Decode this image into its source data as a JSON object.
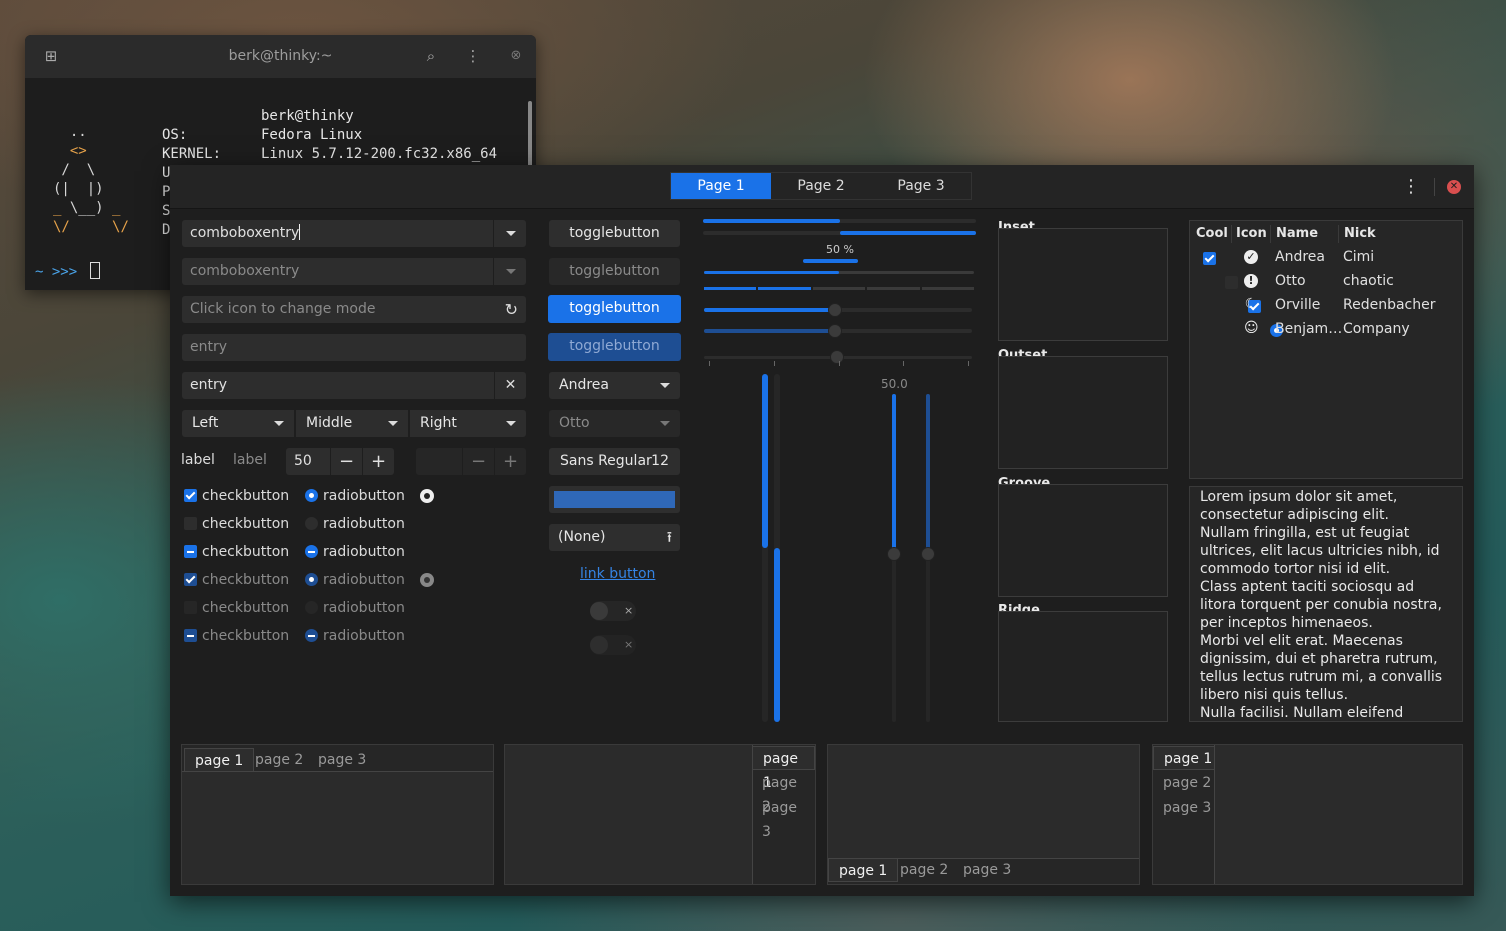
{
  "terminal": {
    "title": "berk@thinky:~",
    "lines": [
      {
        "key": "",
        "value": "berk@thinky"
      },
      {
        "key": "OS:",
        "value": "Fedora Linux"
      },
      {
        "key": "KERNEL:",
        "value": "Linux 5.7.12-200.fc32.x86_64"
      },
      {
        "key": "U",
        "value": ""
      },
      {
        "key": "P",
        "value": ""
      },
      {
        "key": "S",
        "value": ""
      },
      {
        "key": "D",
        "value": ""
      }
    ],
    "prompt": "~ >>>"
  },
  "window": {
    "tabs": [
      "Page 1",
      "Page 2",
      "Page 3"
    ]
  },
  "col1": {
    "combo1": "comboboxentry",
    "combo2": "comboboxentry",
    "mode_placeholder": "Click icon to change mode",
    "entry_placeholder": "entry",
    "entry_value": "entry",
    "segmented": [
      "Left",
      "Middle",
      "Right"
    ],
    "label1": "label",
    "label2": "label",
    "spin_value": "50",
    "checks": [
      "checkbutton",
      "checkbutton",
      "checkbutton",
      "checkbutton",
      "checkbutton",
      "checkbutton"
    ],
    "radios": [
      "radiobutton",
      "radiobutton",
      "radiobutton",
      "radiobutton",
      "radiobutton",
      "radiobutton"
    ]
  },
  "col2": {
    "toggles": [
      "togglebutton",
      "togglebutton",
      "togglebutton",
      "togglebutton"
    ],
    "combo_andrea": "Andrea",
    "combo_otto": "Otto",
    "font_name": "Sans Regular",
    "font_size": "12",
    "color": "#2f68b8",
    "file_none": "(None)",
    "link": "link button",
    "switch_off": "×"
  },
  "col3": {
    "progress_label": "50 %",
    "scale_value": "50.0",
    "progress_top_left": 0.5,
    "progress_mid": 0.5,
    "slider_value": 0.5
  },
  "frames": [
    "Inset",
    "Outset",
    "Groove",
    "Ridge"
  ],
  "tree": {
    "headers": [
      "Cool",
      "Icon",
      "Name",
      "Nick"
    ],
    "rows": [
      {
        "name": "Andrea",
        "nick": "Cimi",
        "icon": "check-circle-icon"
      },
      {
        "name": "Otto",
        "nick": "chaotic",
        "icon": "warning-circle-icon"
      },
      {
        "name": "Orville",
        "nick": "Redenbacher",
        "icon": "moon-icon"
      },
      {
        "name": "Benjam…",
        "nick": "Company",
        "icon": "face-icon"
      }
    ]
  },
  "textview": [
    "Lorem ipsum dolor sit amet, consectetur adipiscing elit.",
    "Nullam fringilla, est ut feugiat ultrices, elit lacus ultricies nibh, id commodo tortor nisi id elit.",
    "Class aptent taciti sociosqu ad litora torquent per conubia nostra, per inceptos himenaeos.",
    "Morbi vel elit erat. Maecenas dignissim, dui et pharetra rutrum, tellus lectus rutrum mi, a convallis libero nisi quis tellus.",
    "Nulla facilisi. Nullam eleifend lobortis"
  ],
  "notebooks": {
    "tabs": [
      "page 1",
      "page 2",
      "page 3"
    ]
  }
}
